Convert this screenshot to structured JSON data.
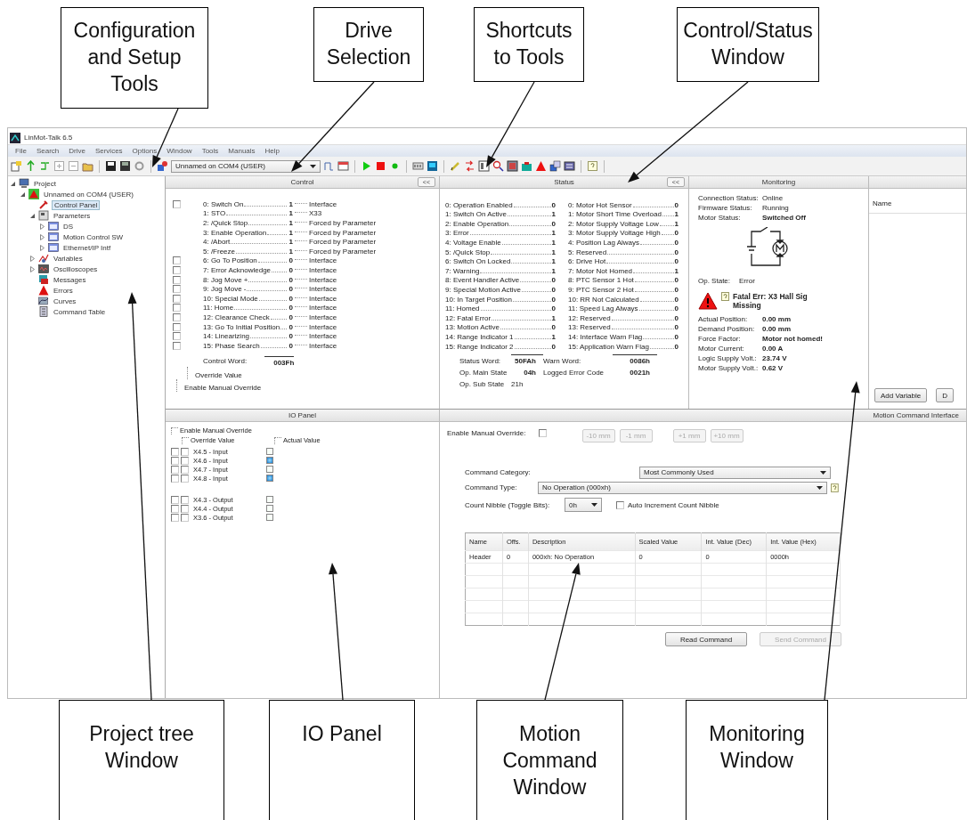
{
  "top_callouts": [
    "Configuration and Setup Tools",
    "Drive Selection",
    "Shortcuts to Tools",
    "Control/Status Window"
  ],
  "window": {
    "title": "LinMot-Talk 6.5"
  },
  "menu": [
    "File",
    "Search",
    "Drive",
    "Services",
    "Options",
    "Window",
    "Tools",
    "Manuals",
    "Help"
  ],
  "toolbar": {
    "drive": "Unnamed on COM4 (USER)"
  },
  "tree": {
    "items": [
      {
        "label": "Project",
        "kind": "project",
        "selected": false,
        "expanded": true,
        "children": [
          {
            "label": "Unnamed on COM4 (USER)",
            "kind": "drive",
            "selected": false,
            "expanded": true,
            "children": [
              {
                "label": "Control Panel",
                "kind": "control",
                "selected": true
              },
              {
                "label": "Parameters",
                "kind": "parameters",
                "selected": false,
                "expanded": true,
                "children": [
                  {
                    "label": "DS",
                    "kind": "module",
                    "selected": false,
                    "expanded": false
                  },
                  {
                    "label": "Motion Control SW",
                    "kind": "module",
                    "selected": false,
                    "expanded": false
                  },
                  {
                    "label": "Ethernet/IP Intf",
                    "kind": "module",
                    "selected": false,
                    "expanded": false
                  }
                ]
              },
              {
                "label": "Variables",
                "kind": "variables",
                "selected": false,
                "expanded": false
              },
              {
                "label": "Oscilloscopes",
                "kind": "scope",
                "selected": false,
                "expanded": false
              },
              {
                "label": "Messages",
                "kind": "messages",
                "selected": false
              },
              {
                "label": "Errors",
                "kind": "errors",
                "selected": false
              },
              {
                "label": "Curves",
                "kind": "curves",
                "selected": false
              },
              {
                "label": "Command Table",
                "kind": "table",
                "selected": false
              }
            ]
          }
        ]
      }
    ]
  },
  "control": {
    "title": "Control",
    "collapse": "<<",
    "rows": [
      {
        "label": "0: Switch On",
        "value": "1",
        "source": "Interface",
        "checked": false
      },
      {
        "label": "1: STO",
        "value": "1",
        "source": "X33"
      },
      {
        "label": "2: /Quick Stop",
        "value": "1",
        "source": "Forced by Parameter"
      },
      {
        "label": "3: Enable Operation",
        "value": "1",
        "source": "Forced by Parameter"
      },
      {
        "label": "4: /Abort",
        "value": "1",
        "source": "Forced by Parameter"
      },
      {
        "label": "5: /Freeze",
        "value": "1",
        "source": "Forced by Parameter"
      },
      {
        "label": "6: Go To Position",
        "value": "0",
        "source": "Interface",
        "checked": false
      },
      {
        "label": "7: Error Acknowledge",
        "value": "0",
        "source": "Interface",
        "checked": false
      },
      {
        "label": "8: Jog Move +",
        "value": "0",
        "source": "Interface",
        "checked": false
      },
      {
        "label": "9: Jog Move -",
        "value": "0",
        "source": "Interface",
        "checked": false
      },
      {
        "label": "10: Special Mode",
        "value": "0",
        "source": "Interface",
        "checked": false
      },
      {
        "label": "11: Home",
        "value": "0",
        "source": "Interface",
        "checked": false
      },
      {
        "label": "12: Clearance Check",
        "value": "0",
        "source": "Interface",
        "checked": false
      },
      {
        "label": "13: Go To Initial Position",
        "value": "0",
        "source": "Interface",
        "checked": false
      },
      {
        "label": "14: Linearizing",
        "value": "0",
        "source": "Interface",
        "checked": false
      },
      {
        "label": "15: Phase Search",
        "value": "0",
        "source": "Interface",
        "checked": false
      }
    ],
    "word_label": "Control Word:",
    "word": "003Fh",
    "override_value": "Override Value",
    "enable_override": "Enable Manual Override"
  },
  "status": {
    "title": "Status",
    "collapse": "<<",
    "left": [
      {
        "label": "0: Operation Enabled",
        "value": "0"
      },
      {
        "label": "1: Switch On Active",
        "value": "1"
      },
      {
        "label": "2: Enable Operation",
        "value": "0"
      },
      {
        "label": "3: Error",
        "value": "1"
      },
      {
        "label": "4: Voltage Enable",
        "value": "1"
      },
      {
        "label": "5: /Quick Stop",
        "value": "1"
      },
      {
        "label": "6: Switch On Locked",
        "value": "1"
      },
      {
        "label": "7: Warning",
        "value": "1"
      },
      {
        "label": "8: Event Handler Active",
        "value": "0"
      },
      {
        "label": "9: Special Motion Active",
        "value": "0"
      },
      {
        "label": "10: In Target Position",
        "value": "0"
      },
      {
        "label": "11: Homed",
        "value": "0"
      },
      {
        "label": "12: Fatal Error",
        "value": "1"
      },
      {
        "label": "13: Motion Active",
        "value": "0"
      },
      {
        "label": "14: Range Indicator 1",
        "value": "1"
      },
      {
        "label": "15: Range Indicator 2",
        "value": "0"
      }
    ],
    "right": [
      {
        "label": "0: Motor Hot Sensor",
        "value": "0"
      },
      {
        "label": "1: Motor Short Time Overload",
        "value": "1"
      },
      {
        "label": "2: Motor Supply Voltage Low",
        "value": "1"
      },
      {
        "label": "3: Motor Supply Voltage High",
        "value": "0"
      },
      {
        "label": "4: Position Lag Always",
        "value": "0"
      },
      {
        "label": "5: Reserved",
        "value": "0"
      },
      {
        "label": "6: Drive Hot",
        "value": "0"
      },
      {
        "label": "7: Motor Not Homed",
        "value": "1"
      },
      {
        "label": "8: PTC Sensor 1 Hot",
        "value": "0"
      },
      {
        "label": "9: PTC Sensor 2 Hot",
        "value": "0"
      },
      {
        "label": "10: RR Not Calculated",
        "value": "0"
      },
      {
        "label": "11: Speed Lag Always",
        "value": "0"
      },
      {
        "label": "12: Reserved",
        "value": "0"
      },
      {
        "label": "13: Reserved",
        "value": "0"
      },
      {
        "label": "14: Interface Warn Flag",
        "value": "0"
      },
      {
        "label": "15: Application Warn Flag",
        "value": "0"
      }
    ],
    "fields": [
      {
        "label": "Status Word:",
        "value": "50FAh"
      },
      {
        "label": "Warn Word:",
        "value": "0086h"
      },
      {
        "label": "Op. Main State",
        "value": "04h"
      },
      {
        "label": "Logged Error Code",
        "value": "0021h"
      },
      {
        "label": "Op. Sub State",
        "value": "21h"
      }
    ]
  },
  "monitoring": {
    "title": "Monitoring",
    "info": [
      {
        "label": "Connection Status:",
        "value": "Online"
      },
      {
        "label": "Firmware Status:",
        "value": "Running"
      },
      {
        "label": "Motor Status:",
        "value": "Switched Off"
      }
    ],
    "op_state": {
      "label": "Op. State:",
      "value": "Error"
    },
    "error": "Fatal Err: X3 Hall Sig Missing",
    "readings": [
      {
        "label": "Actual Position:",
        "value": "0.00 mm"
      },
      {
        "label": "Demand Position:",
        "value": "0.00 mm"
      },
      {
        "label": "Force Factor:",
        "value": "Motor not homed!"
      },
      {
        "label": "Motor Current:",
        "value": "0.00 A"
      },
      {
        "label": "Logic Supply Volt.:",
        "value": "23.74 V"
      },
      {
        "label": "Motor Supply Volt.:",
        "value": "0.62 V"
      }
    ]
  },
  "variables": {
    "columns": [
      "Name"
    ],
    "buttons": [
      "Add Variable",
      "D"
    ]
  },
  "io_panel": {
    "title": "IO Panel",
    "enable_override": "Enable Manual Override",
    "override_value": "Override Value",
    "actual_value": "Actual Value",
    "groups": [
      [
        {
          "label": "X4.5 - Input",
          "enable": false,
          "override": false,
          "actual": false
        },
        {
          "label": "X4.6 - Input",
          "enable": false,
          "override": false,
          "actual": true
        },
        {
          "label": "X4.7 - Input",
          "enable": false,
          "override": false,
          "actual": false
        },
        {
          "label": "X4.8 - Input",
          "enable": false,
          "override": false,
          "actual": true
        }
      ],
      [
        {
          "label": "X4.3 - Output",
          "enable": false,
          "override": false,
          "actual": false
        },
        {
          "label": "X4.4 - Output",
          "enable": false,
          "override": false,
          "actual": false
        },
        {
          "label": "X3.6 - Output",
          "enable": false,
          "override": false,
          "actual": false
        }
      ]
    ]
  },
  "motion": {
    "title": "Motion Command Interface",
    "enable_override": {
      "label": "Enable Manual Override:",
      "checked": false
    },
    "jog_buttons": [
      {
        "label": "-10 mm",
        "disabled": true
      },
      {
        "label": "-1 mm",
        "disabled": true
      },
      {
        "label": "+1 mm",
        "disabled": true
      },
      {
        "label": "+10 mm",
        "disabled": true
      }
    ],
    "category": {
      "label": "Command Category:",
      "value": "Most Commonly Used"
    },
    "type": {
      "label": "Command Type:",
      "value": "No Operation (000xh)"
    },
    "count_nibble": {
      "label": "Count Nibble (Toggle Bits):",
      "value": "0h"
    },
    "auto_increment": {
      "label": "Auto Increment Count Nibble",
      "checked": false
    },
    "table": {
      "columns": [
        "Name",
        "Offs.",
        "Description",
        "Scaled Value",
        "Int. Value (Dec)",
        "Int. Value (Hex)"
      ],
      "rows": [
        [
          "Header",
          "0",
          "000xh: No Operation",
          "0",
          "0",
          "0000h"
        ]
      ]
    },
    "buttons": [
      {
        "label": "Read Command",
        "disabled": false
      },
      {
        "label": "Send Command",
        "disabled": true
      }
    ]
  },
  "bottom_callouts": [
    "Project tree Window",
    "IO Panel",
    "Motion Command Window",
    "Monitoring Window"
  ]
}
